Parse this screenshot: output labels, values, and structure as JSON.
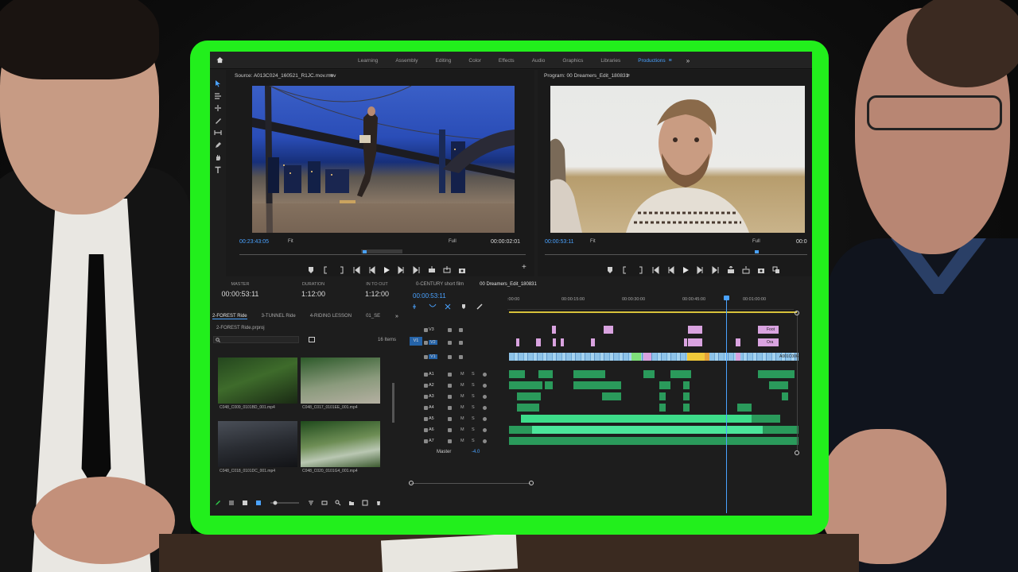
{
  "header": {
    "workspaces": [
      "Learning",
      "Assembly",
      "Editing",
      "Color",
      "Effects",
      "Audio",
      "Graphics",
      "Libraries",
      "Productions"
    ],
    "active_workspace": "Productions",
    "menu_glyph": "≡",
    "more_glyph": "»"
  },
  "source_monitor": {
    "title": "Source: A013C024_160521_R1JC.mov.mov",
    "menu_glyph": "≡",
    "timecode_left": "00:23:43:05",
    "zoom": "Fit",
    "quality": "Full",
    "timecode_right": "00:00:02:01"
  },
  "program_monitor": {
    "title": "Program: 00 Dreamers_Edit_180831",
    "menu_glyph": "≡",
    "timecode_left": "00:00:53:11",
    "zoom": "Fit",
    "quality": "Full",
    "timecode_right": "00:0"
  },
  "metadata": {
    "master_label": "MASTER",
    "master_value": "00:00:53:11",
    "duration_label": "DURATION",
    "duration_value": "1:12:00",
    "inout_label": "IN TO OUT",
    "inout_value": "1:12:00"
  },
  "bin": {
    "tabs": [
      "2-FOREST Ride",
      "3-TUNNEL Ride",
      "4-RIDING LESSON",
      "01_SE"
    ],
    "active_tab": "2-FOREST Ride",
    "path": "2-FOREST Ride.prproj",
    "item_count": "16 Items",
    "clips": [
      "C048_C009_0101BD_001.mp4",
      "C048_C017_0101EE_001.mp4",
      "C048_C018_0101DC_001.mp4",
      "C048_C020_0101G4_001.mp4"
    ]
  },
  "timeline": {
    "tabs": [
      "0-CENTURY short film",
      "00 Dreamers_Edit_180831"
    ],
    "active_tab": "00 Dreamers_Edit_180831",
    "timecode": "00:00:53:11",
    "ruler": [
      ":00:00",
      "00:00:15:00",
      "00:00:30:00",
      "00:00:45:00",
      "00:01:00:00"
    ],
    "video_tracks": [
      "V3",
      "V2",
      "V1"
    ],
    "source_patch": "V1",
    "audio_tracks": [
      "A1",
      "A2",
      "A3",
      "A4",
      "A5",
      "A6",
      "A7"
    ],
    "track_letters": [
      "M",
      "S"
    ],
    "master_label": "Master",
    "master_value": "-4.0",
    "clip_labels": [
      "Foot",
      "Ora",
      "A001C006"
    ]
  },
  "colors": {
    "accent": "#4aa2ff",
    "frame": "#22ef1c",
    "video_clip": "#d9a3e0",
    "video_bar": "#8ec3e8",
    "audio_clip": "#2a9a5b",
    "inout_bar": "#d8c23a"
  }
}
